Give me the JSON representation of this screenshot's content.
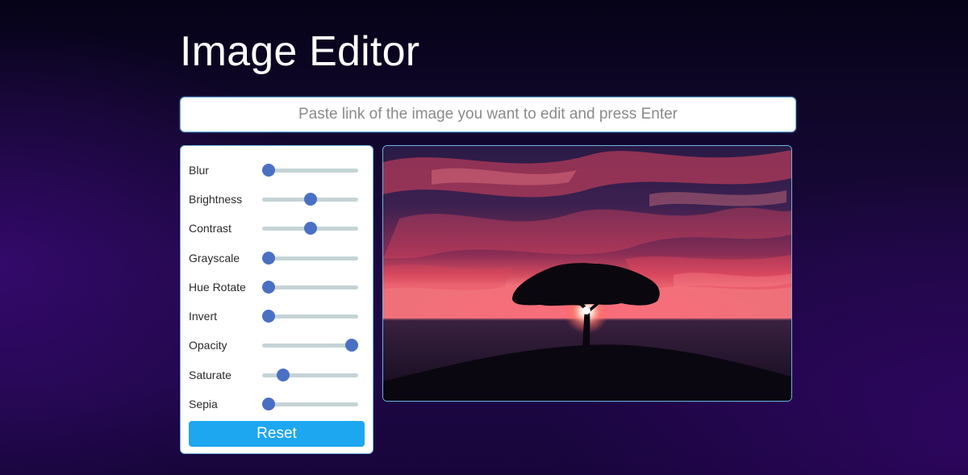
{
  "app": {
    "title": "Image Editor"
  },
  "url_input": {
    "placeholder": "Paste link of the image you want to edit and press Enter",
    "value": ""
  },
  "filters": [
    {
      "label": "Blur",
      "level": 0
    },
    {
      "label": "Brightness",
      "level": 0.5
    },
    {
      "label": "Contrast",
      "level": 0.5
    },
    {
      "label": "Grayscale",
      "level": 0
    },
    {
      "label": "Hue Rotate",
      "level": 0
    },
    {
      "label": "Invert",
      "level": 0
    },
    {
      "label": "Opacity",
      "level": 1
    },
    {
      "label": "Saturate",
      "level": 0.17
    },
    {
      "label": "Sepia",
      "level": 0
    }
  ],
  "reset_label": "Reset",
  "colors": {
    "accent": "#1da7f0",
    "slider_thumb": "#4a70c4",
    "slider_track": "#c5d3d6",
    "border": "#6fb1e3"
  }
}
